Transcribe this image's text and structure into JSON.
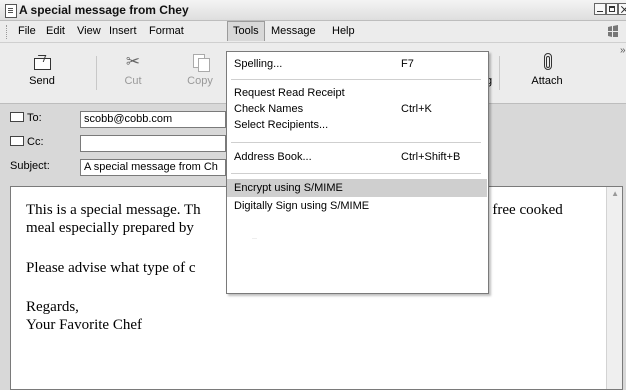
{
  "window": {
    "title": "A special message from Chey"
  },
  "menubar": {
    "items": [
      "File",
      "Edit",
      "View",
      "Insert",
      "Format",
      "Tools",
      "Message",
      "Help"
    ],
    "active": "Tools"
  },
  "toolbar": {
    "buttons": [
      {
        "label": "Send",
        "enabled": true,
        "icon": "send-icon"
      },
      {
        "label": "Cut",
        "enabled": false,
        "icon": "scissors-icon"
      },
      {
        "label": "Copy",
        "enabled": false,
        "icon": "copy-icon"
      },
      {
        "label": "g",
        "enabled": true,
        "icon": "hidden-icon"
      },
      {
        "label": "Attach",
        "enabled": true,
        "icon": "paperclip-icon"
      }
    ]
  },
  "headers": {
    "to_label": "To:",
    "to_value": "scobb@cobb.com",
    "cc_label": "Cc:",
    "cc_value": "",
    "subject_label": "Subject:",
    "subject_value": "A special message from Ch"
  },
  "body": {
    "lines": [
      "This is a special message. Th",
      "e free cooked",
      "meal especially prepared by",
      "Please advise what type of c",
      "Regards,",
      "Your Favorite Chef"
    ]
  },
  "tools_menu": {
    "items": [
      {
        "label": "Spelling...",
        "shortcut": "F7"
      },
      {
        "label": "Request Read Receipt",
        "shortcut": ""
      },
      {
        "label": "Check Names",
        "shortcut": "Ctrl+K"
      },
      {
        "label": "Select Recipients...",
        "shortcut": ""
      },
      {
        "label": "Address Book...",
        "shortcut": "Ctrl+Shift+B"
      },
      {
        "label": "Encrypt using S/MIME",
        "shortcut": ""
      },
      {
        "label": "Digitally Sign using S/MIME",
        "shortcut": ""
      }
    ],
    "selected": "Encrypt using S/MIME"
  }
}
